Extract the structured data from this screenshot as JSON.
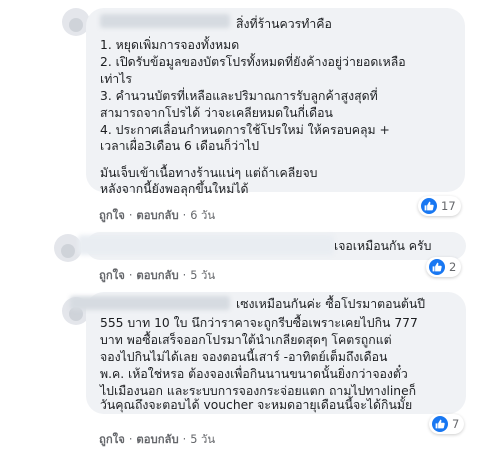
{
  "comments": [
    {
      "lines": [
        "สิ่งที่ร้านควรทำคือ",
        "1. หยุดเพิ่มการจองทั้งหมด",
        "2. เปิดรับข้อมูลของบัตรโปรทั้งหมดที่ยังค้างอยู่ว่ายอดเหลือ",
        "เท่าไร",
        "3. คำนวนบัตรที่เหลือและปริมาณการรับลูกค้าสูงสุดที่",
        "สามารถจากโปรได้ ว่าจะเคลียหมดในกี่เดือน",
        "4. ประกาศเลื่อนกำหนดการใช้โปรใหม่ ให้ครอบคลุม +",
        "เวลาเผื่อ3เดือน 6 เดือนก็ว่าไป",
        "",
        "มันเจ็บเข้าเนื้อทางร้านแน่ๆ แต่ถ้าเคลียจบ",
        "หลังจากนี้ยังพอลุกขึ้นใหม่ได้"
      ],
      "like_label": "ถูกใจ",
      "reply_label": "ตอบกลับ",
      "time": "6 วัน",
      "reaction_count": "17"
    },
    {
      "lines": [
        "เจอเหมือนกัน ครับ"
      ],
      "like_label": "ถูกใจ",
      "reply_label": "ตอบกลับ",
      "time": "5 วัน",
      "reaction_count": "2"
    },
    {
      "lines": [
        "เซงเหมือนกันค่ะ ซื้อโปรมาตอนต้นปี",
        "555 บาท 10 ใบ นึกว่าราคาจะถูกรีบซื้อเพราะเคยไปกิน 777",
        "บาท พอซื้อเสร็จออกโปรมาใต้นำเกลียดสุดๆ โคตรถูกแต่",
        "จองไปกินไม่ได้เลย จองตอนนี้เสาร์ -อาทิตย์เต็มถึงเดือน",
        "พ.ค. เห้อใช่หรอ ต้องจองเพื่อกินนานขนาดนั้นยิ่งกว่าจองตั๋ว",
        "ไปเมืองนอก และระบบการจองกระจ่อยแตก ถามไปทางlineก็",
        "วันคุณถึงจะตอบได้ voucher จะหมดอายุเดือนนี้จะได้กินมั้ย"
      ],
      "like_label": "ถูกใจ",
      "reply_label": "ตอบกลับ",
      "time": "5 วัน",
      "reaction_count": "7"
    }
  ],
  "colors": {
    "bubble": "#f0f2f5",
    "text": "#1c1e21",
    "meta": "#65676b",
    "like": "#1877f2"
  },
  "icons": [
    "avatar",
    "like-icon"
  ]
}
